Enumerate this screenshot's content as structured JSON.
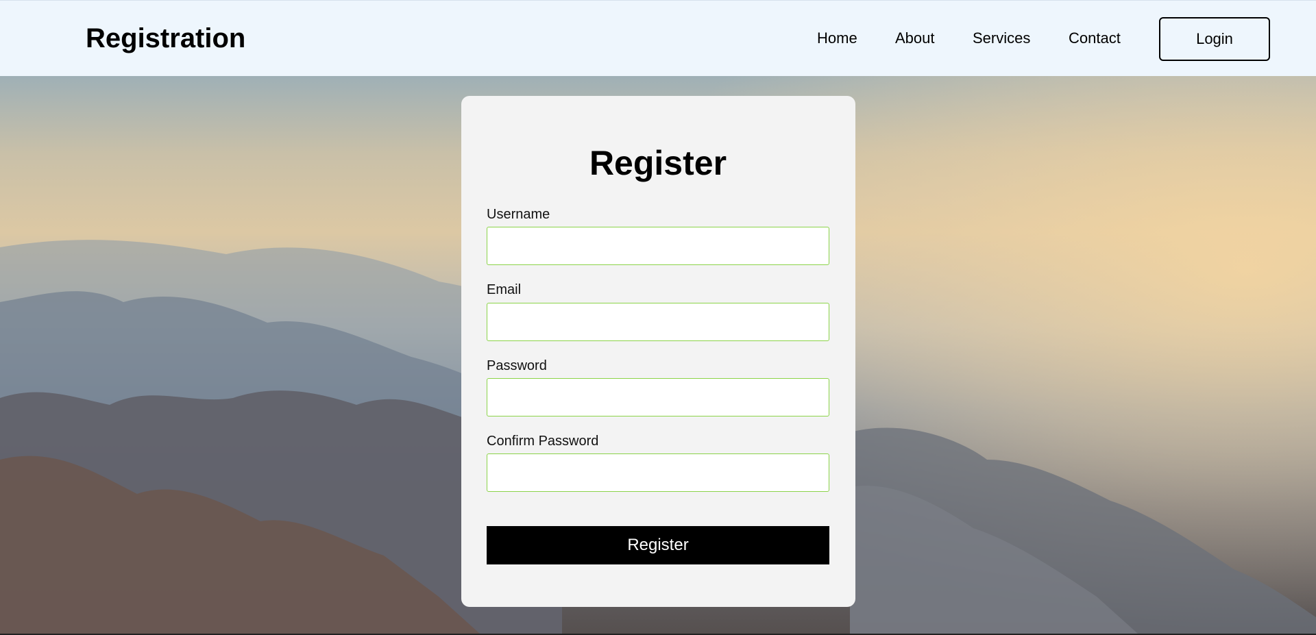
{
  "header": {
    "brand": "Registration",
    "nav": [
      "Home",
      "About",
      "Services",
      "Contact"
    ],
    "login_label": "Login"
  },
  "form": {
    "title": "Register",
    "fields": [
      {
        "label": "Username",
        "value": ""
      },
      {
        "label": "Email",
        "value": ""
      },
      {
        "label": "Password",
        "value": ""
      },
      {
        "label": "Confirm Password",
        "value": ""
      }
    ],
    "submit_label": "Register"
  },
  "colors": {
    "header_bg": "#eef6fd",
    "input_border": "#8bd348",
    "button_bg": "#000000",
    "card_bg": "#f3f3f3"
  }
}
